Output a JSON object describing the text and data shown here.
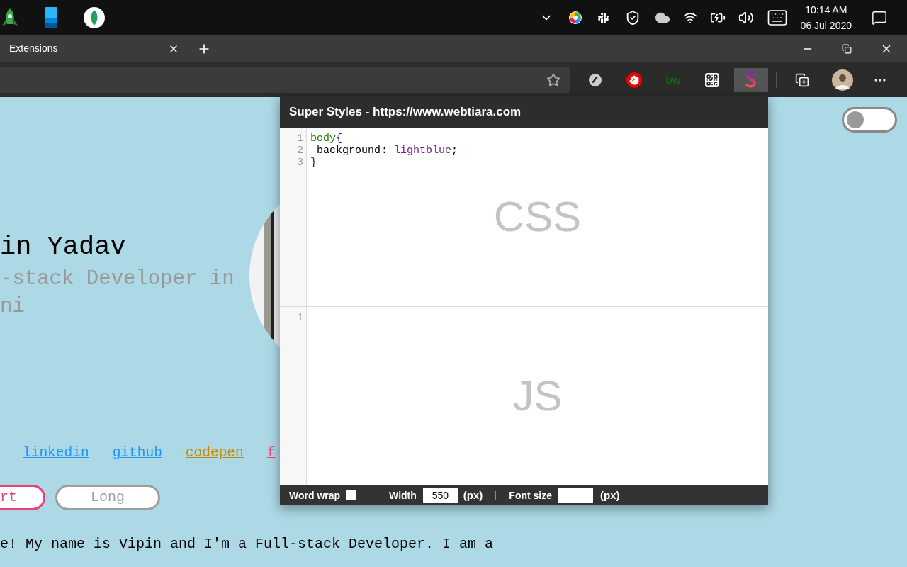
{
  "taskbar": {
    "apps": [
      {
        "kind": "rocket"
      },
      {
        "kind": "phone"
      },
      {
        "kind": "leaf"
      }
    ],
    "clock": {
      "time": "10:14 AM",
      "date": "06 Jul 2020"
    }
  },
  "browser": {
    "tab": {
      "title": "Extensions",
      "selected": true
    },
    "extensions": [
      {
        "kind": "sphere",
        "selected": false
      },
      {
        "kind": "stop",
        "selected": false
      },
      {
        "kind": "bw",
        "label": "bw",
        "selected": false
      },
      {
        "kind": "qr",
        "selected": false
      },
      {
        "kind": "styles",
        "selected": true
      }
    ]
  },
  "page": {
    "heading": "in Yadav",
    "subtitle": "-stack Developer in ni",
    "toggle": {
      "on": false
    },
    "links": [
      {
        "label": "linkedin",
        "color": "#2196f3"
      },
      {
        "label": "github",
        "color": "#2196f3"
      },
      {
        "label": "codepen",
        "color": "#c98a00"
      },
      {
        "label": "f",
        "color": "#ec407a"
      }
    ],
    "buttons": [
      {
        "label": "rt",
        "color": "#ec407a"
      },
      {
        "label": "Long",
        "color": "#9e9e9e"
      }
    ],
    "paragraph": "e! My name is Vipin and I'm a Full-stack Developer. I am a"
  },
  "popup": {
    "title": "Super Styles - https://www.webtiara.com",
    "css_editor": {
      "watermark": "CSS",
      "lines": [
        {
          "number": "1",
          "tokens": [
            {
              "text": "body",
              "kind": "tag"
            },
            {
              "text": "{",
              "kind": "bracket"
            }
          ]
        },
        {
          "number": "2",
          "tokens": [
            {
              "text": " background",
              "kind": "property",
              "caret_after": true
            },
            {
              "text": ": ",
              "kind": "punct"
            },
            {
              "text": "lightblue",
              "kind": "value"
            },
            {
              "text": ";",
              "kind": "punct"
            }
          ]
        },
        {
          "number": "3",
          "tokens": [
            {
              "text": "}",
              "kind": "bracket"
            }
          ]
        }
      ]
    },
    "js_editor": {
      "watermark": "JS",
      "lines": [
        {
          "number": "1"
        }
      ]
    },
    "footer": {
      "word_wrap": {
        "label": "Word wrap",
        "checked": false
      },
      "width": {
        "label": "Width",
        "value": "550",
        "unit": "(px)"
      },
      "font_size": {
        "label": "Font size",
        "unit": "(px)"
      }
    }
  }
}
